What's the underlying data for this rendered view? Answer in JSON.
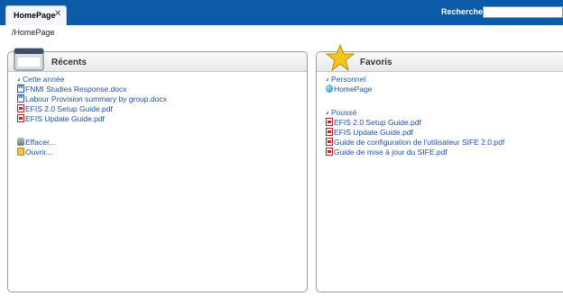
{
  "tab": {
    "label": "HomePage",
    "close_icon": "close-icon"
  },
  "search": {
    "label": "Rechercher:",
    "value": "",
    "placeholder": ""
  },
  "breadcrumb": "/HomePage",
  "recents": {
    "title": "Récents",
    "group": "Cette année",
    "items": [
      {
        "label": "FNMI Studies Response.docx",
        "icon": "word-doc-icon"
      },
      {
        "label": "Labour Provision summary by group.docx",
        "icon": "word-doc-icon"
      },
      {
        "label": "EFIS 2.0 Setup Guide.pdf",
        "icon": "pdf-icon"
      },
      {
        "label": "EFIS Update Guide.pdf",
        "icon": "pdf-icon"
      }
    ],
    "actions": [
      {
        "label": "Effacer...",
        "icon": "eraser-icon"
      },
      {
        "label": "Ouvrir...",
        "icon": "folder-icon"
      }
    ]
  },
  "favorites": {
    "title": "Favoris",
    "personal_group": "Personnel",
    "personal_items": [
      {
        "label": "HomePage",
        "icon": "home-icon"
      }
    ],
    "pushed_group": "Poussé",
    "pushed_items": [
      {
        "label": "EFIS 2.0 Setup Guide.pdf",
        "icon": "pdf-icon"
      },
      {
        "label": "EFIS Update Guide.pdf",
        "icon": "pdf-icon"
      },
      {
        "label": "Guide de configuration de l'utilisateur SIFE 2.0.pdf",
        "icon": "pdf-icon"
      },
      {
        "label": "Guide de mise à jour du SIFE.pdf",
        "icon": "pdf-icon"
      }
    ]
  },
  "colors": {
    "topbar": "#0c5ba8",
    "link": "#1e4fa8"
  }
}
